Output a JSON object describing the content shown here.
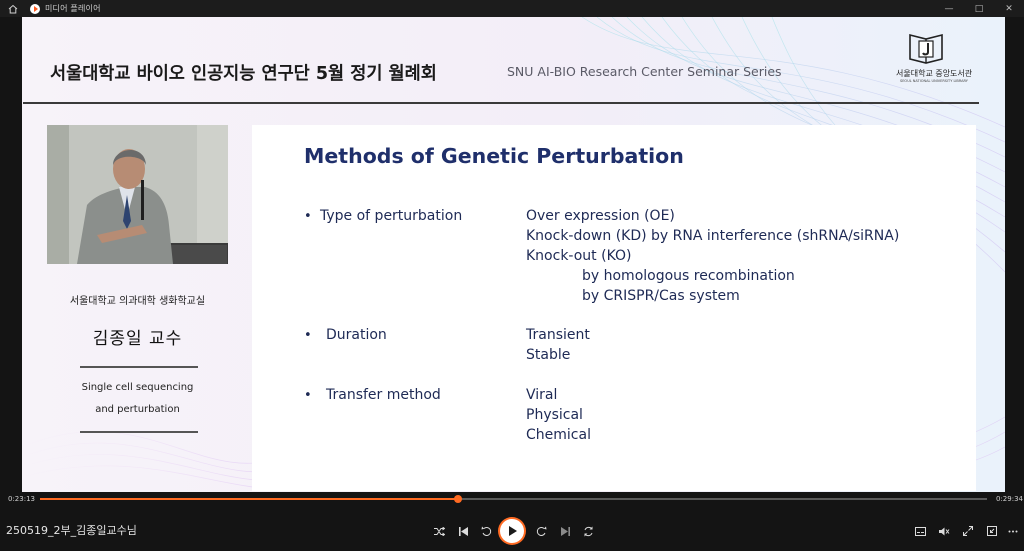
{
  "window": {
    "title": "미디어 플레이어",
    "controls": [
      "—",
      "□",
      "✕"
    ]
  },
  "header": {
    "title": "서울대학교 바이오 인공지능 연구단 5월 정기 월례회",
    "subtitle": "SNU AI-BIO Research Center Seminar Series",
    "library_name": "서울대학교 중앙도서관",
    "library_name_en": "SEOUL NATIONAL UNIVERSITY LIBRARY"
  },
  "speaker": {
    "affiliation": "서울대학교 의과대학 생화학교실",
    "name": "김종일 교수",
    "topic_line1": "Single cell sequencing",
    "topic_line2": "and perturbation"
  },
  "slide": {
    "title": "Methods of Genetic Perturbation",
    "rows": [
      {
        "bullet": "•",
        "label": "Type of perturbation",
        "values": [
          "Over expression (OE)",
          "Knock-down (KD) by RNA interference (shRNA/siRNA)",
          "Knock-out (KO)",
          "by homologous recombination",
          "by CRISPR/Cas system"
        ]
      },
      {
        "bullet": "•",
        "label": "Duration",
        "values": [
          "Transient",
          "Stable"
        ]
      },
      {
        "bullet": "•",
        "label": "Transfer method",
        "values": [
          "Viral",
          "Physical",
          "Chemical"
        ]
      }
    ]
  },
  "player": {
    "current_time": "0:23:13",
    "total_time": "0:29:34",
    "progress": 0.441,
    "filename": "250519_2부_김종일교수님",
    "accent_color": "#ff6a22",
    "icons": [
      "shuffle-icon",
      "prev-icon",
      "rewind-icon",
      "play-icon",
      "forward-icon",
      "next-icon",
      "repeat-icon",
      "subtitle-icon",
      "volume-icon",
      "fullscreen-icon",
      "pip-icon",
      "more-icon"
    ]
  }
}
